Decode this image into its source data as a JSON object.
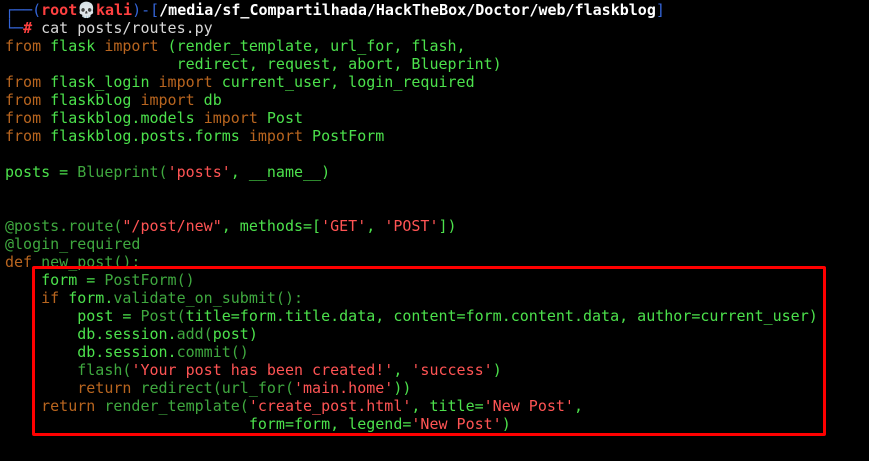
{
  "colors": {
    "background": "#000000",
    "highlight_border": "#ff0000"
  },
  "terminal": {
    "lines": [
      {
        "segments": [
          {
            "text": "┌──(",
            "color": "#3465d8"
          },
          {
            "text": "root",
            "color": "#ff4040",
            "bold": true
          },
          {
            "text": "💀",
            "color": "#ffffff"
          },
          {
            "text": "kali",
            "color": "#ff4040",
            "bold": true
          },
          {
            "text": ")-[",
            "color": "#3465d8"
          },
          {
            "text": "/media/sf_Compartilhada/HackTheBox/Doctor/web/flaskblog",
            "color": "#ffffff",
            "bold": true
          },
          {
            "text": "]",
            "color": "#3465d8"
          }
        ]
      },
      {
        "segments": [
          {
            "text": "└─",
            "color": "#3465d8"
          },
          {
            "text": "#",
            "color": "#ff4040",
            "bold": true
          },
          {
            "text": " cat posts/routes.py",
            "color": "#d8d8d8"
          }
        ]
      },
      {
        "segments": [
          {
            "text": "from",
            "color": "#b8651f"
          },
          {
            "text": " flask ",
            "color": "#4ce14c"
          },
          {
            "text": "import",
            "color": "#b8651f"
          },
          {
            "text": " (render_template, url_for, flash,",
            "color": "#4ce14c"
          }
        ]
      },
      {
        "segments": [
          {
            "text": "                   redirect, request, abort, Blueprint)",
            "color": "#4ce14c"
          }
        ]
      },
      {
        "segments": [
          {
            "text": "from",
            "color": "#b8651f"
          },
          {
            "text": " flask_login ",
            "color": "#4ce14c"
          },
          {
            "text": "import",
            "color": "#b8651f"
          },
          {
            "text": " current_user, login_required",
            "color": "#4ce14c"
          }
        ]
      },
      {
        "segments": [
          {
            "text": "from",
            "color": "#b8651f"
          },
          {
            "text": " flaskblog ",
            "color": "#4ce14c"
          },
          {
            "text": "import",
            "color": "#b8651f"
          },
          {
            "text": " db",
            "color": "#4ce14c"
          }
        ]
      },
      {
        "segments": [
          {
            "text": "from",
            "color": "#b8651f"
          },
          {
            "text": " flaskblog.models ",
            "color": "#4ce14c"
          },
          {
            "text": "import",
            "color": "#b8651f"
          },
          {
            "text": " Post",
            "color": "#4ce14c"
          }
        ]
      },
      {
        "segments": [
          {
            "text": "from",
            "color": "#b8651f"
          },
          {
            "text": " flaskblog.posts.forms ",
            "color": "#4ce14c"
          },
          {
            "text": "import",
            "color": "#b8651f"
          },
          {
            "text": " PostForm",
            "color": "#4ce14c"
          }
        ]
      },
      {
        "segments": []
      },
      {
        "segments": [
          {
            "text": "posts = ",
            "color": "#4ce14c"
          },
          {
            "text": "Blueprint(",
            "color": "#3fa83f"
          },
          {
            "text": "'posts'",
            "color": "#ff5454"
          },
          {
            "text": ", __name__)",
            "color": "#4ce14c"
          }
        ]
      },
      {
        "segments": []
      },
      {
        "segments": []
      },
      {
        "segments": [
          {
            "text": "@posts.route(",
            "color": "#3fa83f"
          },
          {
            "text": "\"/post/new\"",
            "color": "#ff5454"
          },
          {
            "text": ", methods=[",
            "color": "#4ce14c"
          },
          {
            "text": "'GET'",
            "color": "#ff5454"
          },
          {
            "text": ", ",
            "color": "#4ce14c"
          },
          {
            "text": "'POST'",
            "color": "#ff5454"
          },
          {
            "text": "])",
            "color": "#4ce14c"
          }
        ]
      },
      {
        "segments": [
          {
            "text": "@login_required",
            "color": "#3fa83f"
          }
        ]
      },
      {
        "segments": [
          {
            "text": "def",
            "color": "#b8651f"
          },
          {
            "text": " new_post():",
            "color": "#3fa83f"
          }
        ]
      },
      {
        "segments": [
          {
            "text": "    form = ",
            "color": "#4ce14c"
          },
          {
            "text": "PostForm()",
            "color": "#3fa83f"
          }
        ]
      },
      {
        "segments": [
          {
            "text": "    ",
            "color": "#4ce14c"
          },
          {
            "text": "if",
            "color": "#b8651f"
          },
          {
            "text": " form.",
            "color": "#4ce14c"
          },
          {
            "text": "validate_on_submit():",
            "color": "#3fa83f"
          }
        ]
      },
      {
        "segments": [
          {
            "text": "        post = ",
            "color": "#4ce14c"
          },
          {
            "text": "Post(",
            "color": "#3fa83f"
          },
          {
            "text": "title=form.title.data, content=form.content.data, author=current_user)",
            "color": "#4ce14c"
          }
        ]
      },
      {
        "segments": [
          {
            "text": "        db.session.",
            "color": "#4ce14c"
          },
          {
            "text": "add(",
            "color": "#3fa83f"
          },
          {
            "text": "post)",
            "color": "#4ce14c"
          }
        ]
      },
      {
        "segments": [
          {
            "text": "        db.session.",
            "color": "#4ce14c"
          },
          {
            "text": "commit()",
            "color": "#3fa83f"
          }
        ]
      },
      {
        "segments": [
          {
            "text": "        flash(",
            "color": "#3fa83f"
          },
          {
            "text": "'Your post has been created!'",
            "color": "#ff5454"
          },
          {
            "text": ", ",
            "color": "#4ce14c"
          },
          {
            "text": "'success'",
            "color": "#ff5454"
          },
          {
            "text": ")",
            "color": "#4ce14c"
          }
        ]
      },
      {
        "segments": [
          {
            "text": "        ",
            "color": "#4ce14c"
          },
          {
            "text": "return",
            "color": "#b8651f"
          },
          {
            "text": " redirect(url_for(",
            "color": "#3fa83f"
          },
          {
            "text": "'main.home'",
            "color": "#ff5454"
          },
          {
            "text": "))",
            "color": "#4ce14c"
          }
        ]
      },
      {
        "segments": [
          {
            "text": "    ",
            "color": "#4ce14c"
          },
          {
            "text": "return",
            "color": "#b8651f"
          },
          {
            "text": " render_template(",
            "color": "#3fa83f"
          },
          {
            "text": "'create_post.html'",
            "color": "#ff5454"
          },
          {
            "text": ", title=",
            "color": "#4ce14c"
          },
          {
            "text": "'New Post'",
            "color": "#ff5454"
          },
          {
            "text": ",",
            "color": "#4ce14c"
          }
        ]
      },
      {
        "segments": [
          {
            "text": "                           form=form, legend=",
            "color": "#4ce14c"
          },
          {
            "text": "'New Post'",
            "color": "#ff5454"
          },
          {
            "text": ")",
            "color": "#4ce14c"
          }
        ]
      }
    ]
  }
}
